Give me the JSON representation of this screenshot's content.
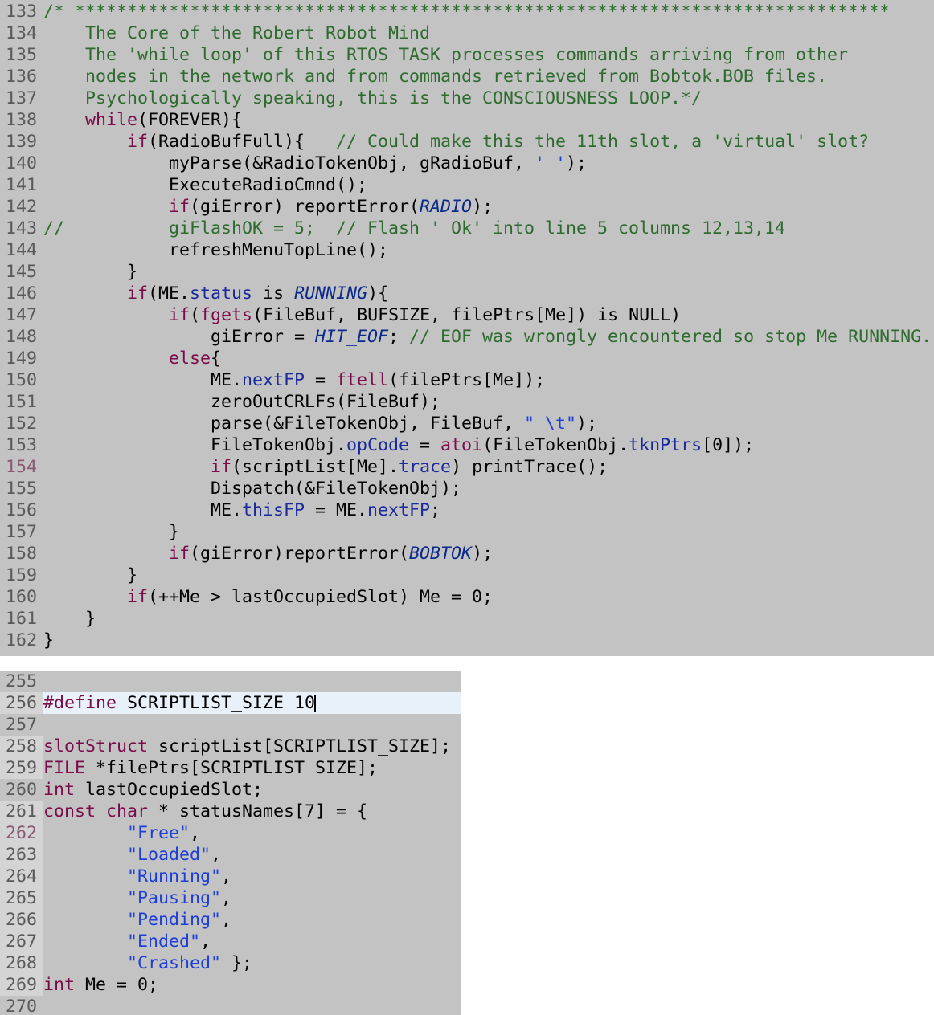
{
  "top_editor": {
    "lines": [
      {
        "n": "133",
        "parts": [
          {
            "t": "/* ******************************************************************************",
            "c": "cm"
          }
        ]
      },
      {
        "n": "134",
        "parts": [
          {
            "t": "    The Core of the Robert Robot Mind",
            "c": "cm"
          }
        ]
      },
      {
        "n": "135",
        "parts": [
          {
            "t": "    The 'while loop' of this RTOS TASK processes commands arriving from other",
            "c": "cm"
          }
        ]
      },
      {
        "n": "136",
        "parts": [
          {
            "t": "    nodes in the network and from commands retrieved from Bobtok.BOB files.",
            "c": "cm"
          }
        ]
      },
      {
        "n": "137",
        "parts": [
          {
            "t": "    Psychologically speaking, this is the CONSCIOUSNESS LOOP.*/",
            "c": "cm"
          }
        ]
      },
      {
        "n": "138",
        "parts": [
          {
            "t": "    ",
            "c": ""
          },
          {
            "t": "while",
            "c": "k"
          },
          {
            "t": "(FOREVER){",
            "c": ""
          }
        ]
      },
      {
        "n": "139",
        "parts": [
          {
            "t": "        ",
            "c": ""
          },
          {
            "t": "if",
            "c": "k"
          },
          {
            "t": "(RadioBufFull){   ",
            "c": ""
          },
          {
            "t": "// Could make this the 11th slot, a 'virtual' slot?",
            "c": "cm"
          }
        ]
      },
      {
        "n": "140",
        "parts": [
          {
            "t": "            myParse(&RadioTokenObj, gRadioBuf, ",
            "c": ""
          },
          {
            "t": "' '",
            "c": "s"
          },
          {
            "t": ");",
            "c": ""
          }
        ]
      },
      {
        "n": "141",
        "parts": [
          {
            "t": "            ExecuteRadioCmnd();",
            "c": ""
          }
        ]
      },
      {
        "n": "142",
        "parts": [
          {
            "t": "            ",
            "c": ""
          },
          {
            "t": "if",
            "c": "k"
          },
          {
            "t": "(giError) reportError(",
            "c": ""
          },
          {
            "t": "RADIO",
            "c": "c"
          },
          {
            "t": ");",
            "c": ""
          }
        ]
      },
      {
        "n": "143",
        "parts": [
          {
            "t": "//          giFlashOK = 5;  // Flash ' Ok' into line 5 columns 12,13,14",
            "c": "cm"
          }
        ]
      },
      {
        "n": "144",
        "parts": [
          {
            "t": "            refreshMenuTopLine();",
            "c": ""
          }
        ]
      },
      {
        "n": "145",
        "parts": [
          {
            "t": "        }",
            "c": ""
          }
        ]
      },
      {
        "n": "146",
        "parts": [
          {
            "t": "        ",
            "c": ""
          },
          {
            "t": "if",
            "c": "k"
          },
          {
            "t": "(ME.",
            "c": ""
          },
          {
            "t": "status",
            "c": "m"
          },
          {
            "t": " is ",
            "c": ""
          },
          {
            "t": "RUNNING",
            "c": "c"
          },
          {
            "t": "){",
            "c": ""
          }
        ]
      },
      {
        "n": "147",
        "parts": [
          {
            "t": "            ",
            "c": ""
          },
          {
            "t": "if",
            "c": "k"
          },
          {
            "t": "(",
            "c": ""
          },
          {
            "t": "fgets",
            "c": "k"
          },
          {
            "t": "(FileBuf, BUFSIZE, filePtrs[Me]) is NULL)",
            "c": ""
          }
        ]
      },
      {
        "n": "148",
        "parts": [
          {
            "t": "                giError = ",
            "c": ""
          },
          {
            "t": "HIT_EOF",
            "c": "c"
          },
          {
            "t": "; ",
            "c": ""
          },
          {
            "t": "// EOF was wrongly encountered so stop Me RUNNING.",
            "c": "cm"
          }
        ]
      },
      {
        "n": "149",
        "parts": [
          {
            "t": "            ",
            "c": ""
          },
          {
            "t": "else",
            "c": "k"
          },
          {
            "t": "{",
            "c": ""
          }
        ]
      },
      {
        "n": "150",
        "parts": [
          {
            "t": "                ME.",
            "c": ""
          },
          {
            "t": "nextFP",
            "c": "m"
          },
          {
            "t": " = ",
            "c": ""
          },
          {
            "t": "ftell",
            "c": "k"
          },
          {
            "t": "(filePtrs[Me]);",
            "c": ""
          }
        ]
      },
      {
        "n": "151",
        "parts": [
          {
            "t": "                zeroOutCRLFs(FileBuf);",
            "c": ""
          }
        ]
      },
      {
        "n": "152",
        "parts": [
          {
            "t": "                parse(&FileTokenObj, FileBuf, ",
            "c": ""
          },
          {
            "t": "\" \\t\"",
            "c": "s"
          },
          {
            "t": ");",
            "c": ""
          }
        ]
      },
      {
        "n": "153",
        "parts": [
          {
            "t": "                FileTokenObj.",
            "c": ""
          },
          {
            "t": "opCode",
            "c": "m"
          },
          {
            "t": " = ",
            "c": ""
          },
          {
            "t": "atoi",
            "c": "k"
          },
          {
            "t": "(FileTokenObj.",
            "c": ""
          },
          {
            "t": "tknPtrs",
            "c": "m"
          },
          {
            "t": "[0]);",
            "c": ""
          }
        ]
      },
      {
        "n": "154",
        "parts": [
          {
            "t": "                ",
            "c": ""
          },
          {
            "t": "if",
            "c": "k"
          },
          {
            "t": "(scriptList[Me].",
            "c": ""
          },
          {
            "t": "trace",
            "c": "m"
          },
          {
            "t": ") printTrace();",
            "c": ""
          }
        ]
      },
      {
        "n": "155",
        "parts": [
          {
            "t": "                Dispatch(&FileTokenObj);",
            "c": ""
          }
        ]
      },
      {
        "n": "156",
        "parts": [
          {
            "t": "                ME.",
            "c": ""
          },
          {
            "t": "thisFP",
            "c": "m"
          },
          {
            "t": " = ME.",
            "c": ""
          },
          {
            "t": "nextFP",
            "c": "m"
          },
          {
            "t": ";",
            "c": ""
          }
        ]
      },
      {
        "n": "157",
        "parts": [
          {
            "t": "            }",
            "c": ""
          }
        ]
      },
      {
        "n": "158",
        "parts": [
          {
            "t": "            ",
            "c": ""
          },
          {
            "t": "if",
            "c": "k"
          },
          {
            "t": "(giError)reportError(",
            "c": ""
          },
          {
            "t": "BOBTOK",
            "c": "c"
          },
          {
            "t": ");",
            "c": ""
          }
        ]
      },
      {
        "n": "159",
        "parts": [
          {
            "t": "        }",
            "c": ""
          }
        ]
      },
      {
        "n": "160",
        "parts": [
          {
            "t": "        ",
            "c": ""
          },
          {
            "t": "if",
            "c": "k"
          },
          {
            "t": "(++Me > lastOccupiedSlot) Me = 0;",
            "c": ""
          }
        ]
      },
      {
        "n": "161",
        "parts": [
          {
            "t": "    }",
            "c": ""
          }
        ]
      },
      {
        "n": "162",
        "parts": [
          {
            "t": "}",
            "c": ""
          }
        ]
      }
    ]
  },
  "bottom_editor": {
    "lines": [
      {
        "n": "255",
        "parts": []
      },
      {
        "n": "256",
        "parts": [
          {
            "t": "#define",
            "c": "k"
          },
          {
            "t": " SCRIPTLIST_SIZE 10",
            "c": ""
          }
        ],
        "current": true
      },
      {
        "n": "257",
        "parts": []
      },
      {
        "n": "258",
        "parts": [
          {
            "t": "slotStruct",
            "c": "k"
          },
          {
            "t": " scriptList[SCRIPTLIST_SIZE];",
            "c": ""
          }
        ]
      },
      {
        "n": "259",
        "parts": [
          {
            "t": "FILE",
            "c": "k"
          },
          {
            "t": " *filePtrs[SCRIPTLIST_SIZE];",
            "c": ""
          }
        ]
      },
      {
        "n": "260",
        "parts": [
          {
            "t": "int",
            "c": "k"
          },
          {
            "t": " lastOccupiedSlot;",
            "c": ""
          }
        ]
      },
      {
        "n": "261",
        "parts": [
          {
            "t": "const",
            "c": "k"
          },
          {
            "t": " ",
            "c": ""
          },
          {
            "t": "char",
            "c": "k"
          },
          {
            "t": " * statusNames[7] = {",
            "c": ""
          }
        ]
      },
      {
        "n": "262",
        "parts": [
          {
            "t": "        ",
            "c": ""
          },
          {
            "t": "\"Free\"",
            "c": "s"
          },
          {
            "t": ",",
            "c": ""
          }
        ]
      },
      {
        "n": "263",
        "parts": [
          {
            "t": "        ",
            "c": ""
          },
          {
            "t": "\"Loaded\"",
            "c": "s"
          },
          {
            "t": ",",
            "c": ""
          }
        ]
      },
      {
        "n": "264",
        "parts": [
          {
            "t": "        ",
            "c": ""
          },
          {
            "t": "\"Running\"",
            "c": "s"
          },
          {
            "t": ",",
            "c": ""
          }
        ]
      },
      {
        "n": "265",
        "parts": [
          {
            "t": "        ",
            "c": ""
          },
          {
            "t": "\"Pausing\"",
            "c": "s"
          },
          {
            "t": ",",
            "c": ""
          }
        ]
      },
      {
        "n": "266",
        "parts": [
          {
            "t": "        ",
            "c": ""
          },
          {
            "t": "\"Pending\"",
            "c": "s"
          },
          {
            "t": ",",
            "c": ""
          }
        ]
      },
      {
        "n": "267",
        "parts": [
          {
            "t": "        ",
            "c": ""
          },
          {
            "t": "\"Ended\"",
            "c": "s"
          },
          {
            "t": ",",
            "c": ""
          }
        ]
      },
      {
        "n": "268",
        "parts": [
          {
            "t": "        ",
            "c": ""
          },
          {
            "t": "\"Crashed\"",
            "c": "s"
          },
          {
            "t": " };",
            "c": ""
          }
        ]
      },
      {
        "n": "269",
        "parts": [
          {
            "t": "int",
            "c": "k"
          },
          {
            "t": " Me = 0;",
            "c": ""
          }
        ]
      },
      {
        "n": "270",
        "parts": []
      }
    ]
  }
}
